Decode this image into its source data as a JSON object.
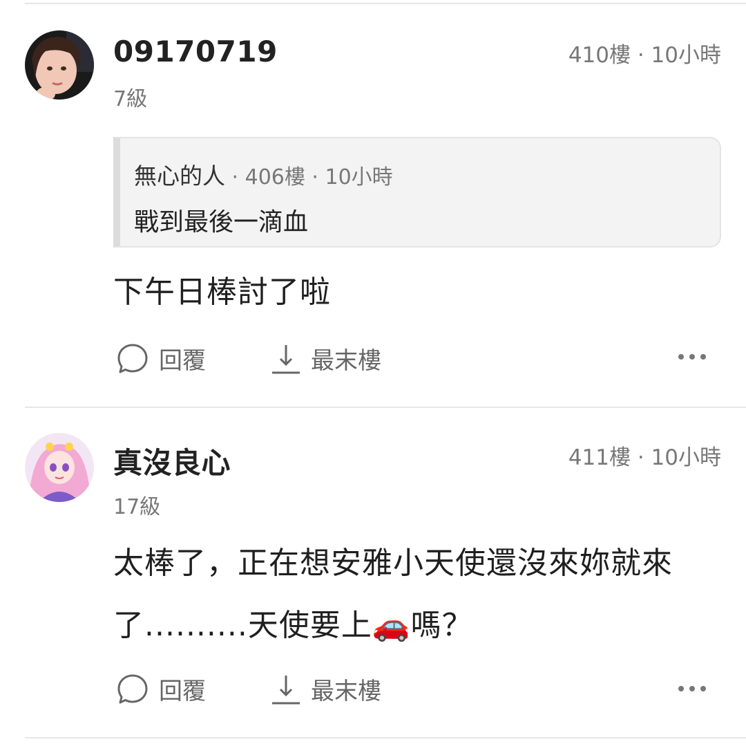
{
  "posts": [
    {
      "username": "09170719",
      "level": "7級",
      "floor": "410樓",
      "time": "10小時",
      "quote": {
        "author": "無心的人",
        "floor": "406樓",
        "time": "10小時",
        "text": "戰到最後一滴血"
      },
      "content": "下午日棒討了啦",
      "reply_label": "回覆",
      "last_floor_label": "最末樓"
    },
    {
      "username": "真沒良心",
      "level": "17級",
      "floor": "411樓",
      "time": "10小時",
      "content": "太棒了，正在想安雅小天使還沒來妳就來了..........天使要上🚗嗎？",
      "reply_label": "回覆",
      "last_floor_label": "最末樓"
    }
  ]
}
